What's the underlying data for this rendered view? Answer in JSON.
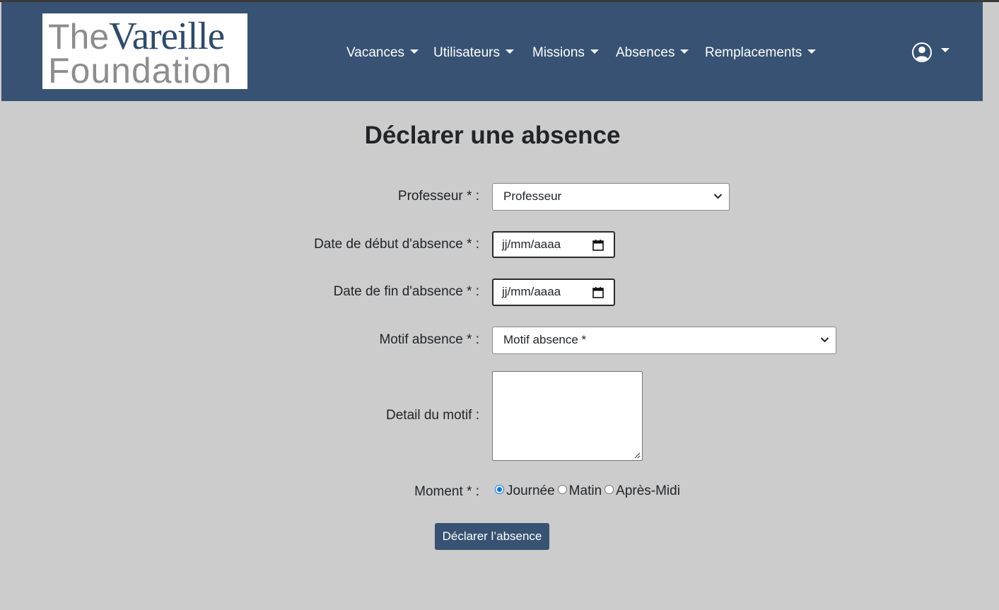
{
  "brand": {
    "logo_the": "The",
    "logo_vareille": "Vareille",
    "logo_foundation": "Foundation"
  },
  "nav": {
    "items": [
      {
        "label": "Vacances"
      },
      {
        "label": "Utilisateurs"
      },
      {
        "label": "Missions"
      },
      {
        "label": "Absences"
      },
      {
        "label": "Remplacements"
      }
    ],
    "user_icon": "user-circle-icon"
  },
  "form": {
    "title": "Déclarer une absence",
    "professeur_label": "Professeur * :",
    "professeur_value": "Professeur",
    "date_debut_label": "Date de début d'absence * :",
    "date_debut_value": "jj/mm/aaaa",
    "date_fin_label": "Date de fin d'absence * :",
    "date_fin_value": "jj/mm/aaaa",
    "motif_label": "Motif absence * :",
    "motif_value": "Motif absence *",
    "detail_label": "Detail du motif :",
    "detail_value": "",
    "moment_label": "Moment * :",
    "moment_options": [
      {
        "label": "Journée",
        "checked": true
      },
      {
        "label": "Matin",
        "checked": false
      },
      {
        "label": "Après-Midi",
        "checked": false
      }
    ],
    "submit_label": "Déclarer l’absence"
  },
  "colors": {
    "navbar": "#375272",
    "background": "#cccccc",
    "button": "#375272",
    "radio_accent": "#0075ff"
  }
}
